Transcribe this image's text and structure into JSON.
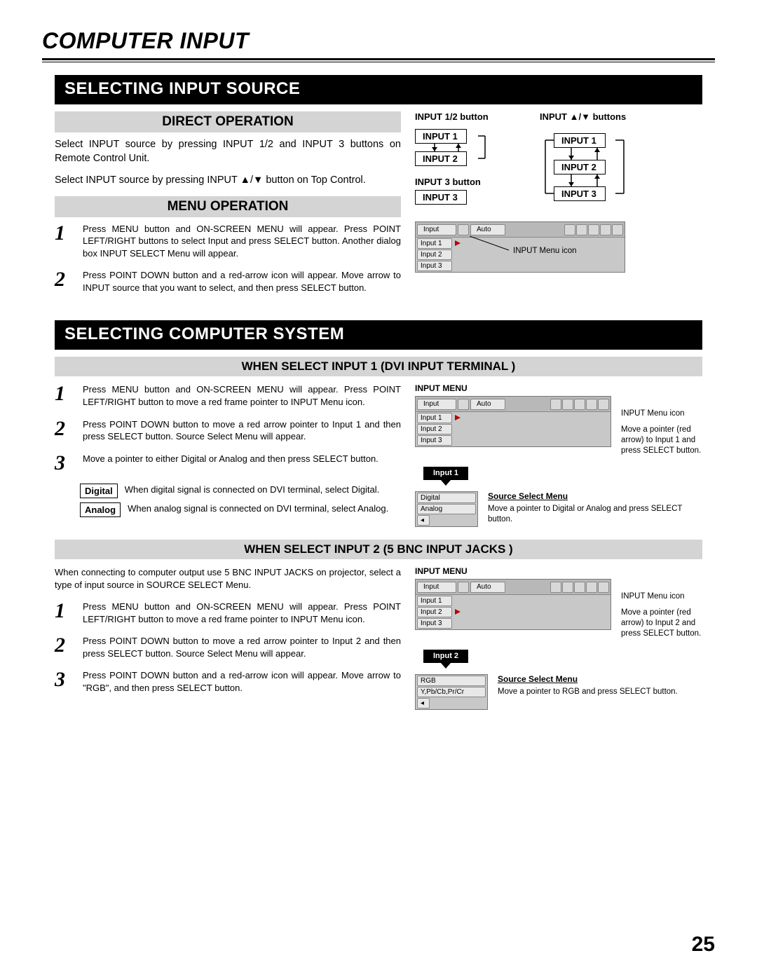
{
  "page_title": "COMPUTER INPUT",
  "page_number": "25",
  "section1": {
    "banner": "SELECTING INPUT SOURCE",
    "direct_header": "DIRECT OPERATION",
    "direct_p1": "Select INPUT source by pressing INPUT 1/2 and INPUT 3 buttons on Remote Control Unit.",
    "direct_p2": "Select INPUT source by pressing INPUT ▲/▼ button on Top Control.",
    "menu_header": "MENU OPERATION",
    "step1": "Press MENU button and ON-SCREEN MENU will appear. Press POINT LEFT/RIGHT buttons to select Input and press SELECT button. Another dialog box INPUT SELECT Menu will appear.",
    "step2": "Press POINT DOWN button and a red-arrow icon will appear. Move arrow to INPUT source that you want to select, and then press SELECT button.",
    "diag": {
      "label12": "INPUT 1/2 button",
      "labelud": "INPUT ▲/▼  buttons",
      "in1": "INPUT 1",
      "in2": "INPUT 2",
      "label3": "INPUT 3 button",
      "in3": "INPUT 3"
    },
    "menu_icon_label": "INPUT Menu icon",
    "menu_mock": {
      "title": "Input",
      "auto": "Auto",
      "items": [
        "Input 1",
        "Input 2",
        "Input 3"
      ]
    }
  },
  "section2": {
    "banner": "SELECTING COMPUTER SYSTEM",
    "sub1": "WHEN SELECT  INPUT 1 (DVI INPUT TERMINAL )",
    "s1_step1": "Press MENU button and ON-SCREEN MENU will appear. Press POINT LEFT/RIGHT button to move a red frame pointer to INPUT Menu icon.",
    "s1_step2": "Press POINT DOWN button to move a red arrow pointer to Input 1 and then press SELECT button. Source Select Menu will appear.",
    "s1_step3": "Move a pointer to either Digital or Analog and then press SELECT button.",
    "digital_label": "Digital",
    "digital_text": "When digital signal is connected on DVI terminal, select Digital.",
    "analog_label": "Analog",
    "analog_text": "When analog signal is connected on DVI terminal, select Analog.",
    "right_input_menu": "INPUT MENU",
    "right_menu_icon": "INPUT Menu icon",
    "right_caption1": "Move a pointer (red arrow) to Input 1 and press SELECT button.",
    "input1_tab": "Input 1",
    "source_select": "Source Select Menu",
    "source_caption": "Move a pointer to Digital or Analog and press SELECT button.",
    "source_items": [
      "Digital",
      "Analog"
    ],
    "sub2": "WHEN SELECT INPUT 2 (5 BNC INPUT JACKS )",
    "s2_intro": "When connecting to computer output use 5 BNC INPUT JACKS on projector, select a type of input source in SOURCE SELECT Menu.",
    "s2_step1": "Press MENU button and ON-SCREEN MENU will appear. Press POINT LEFT/RIGHT button to move a red frame pointer to INPUT Menu icon.",
    "s2_step2": "Press POINT DOWN button to move a red arrow pointer to Input 2 and then press SELECT button. Source Select Menu will appear.",
    "s2_step3": "Press POINT DOWN button and a red-arrow icon will appear. Move arrow to \"RGB\", and then press SELECT button.",
    "right2_caption1": "Move a pointer (red arrow) to Input 2 and press SELECT button.",
    "input2_tab": "Input 2",
    "source2_caption": "Move a pointer to RGB and press SELECT button.",
    "source2_items": [
      "RGB",
      "Y,Pb/Cb,Pr/Cr"
    ]
  }
}
